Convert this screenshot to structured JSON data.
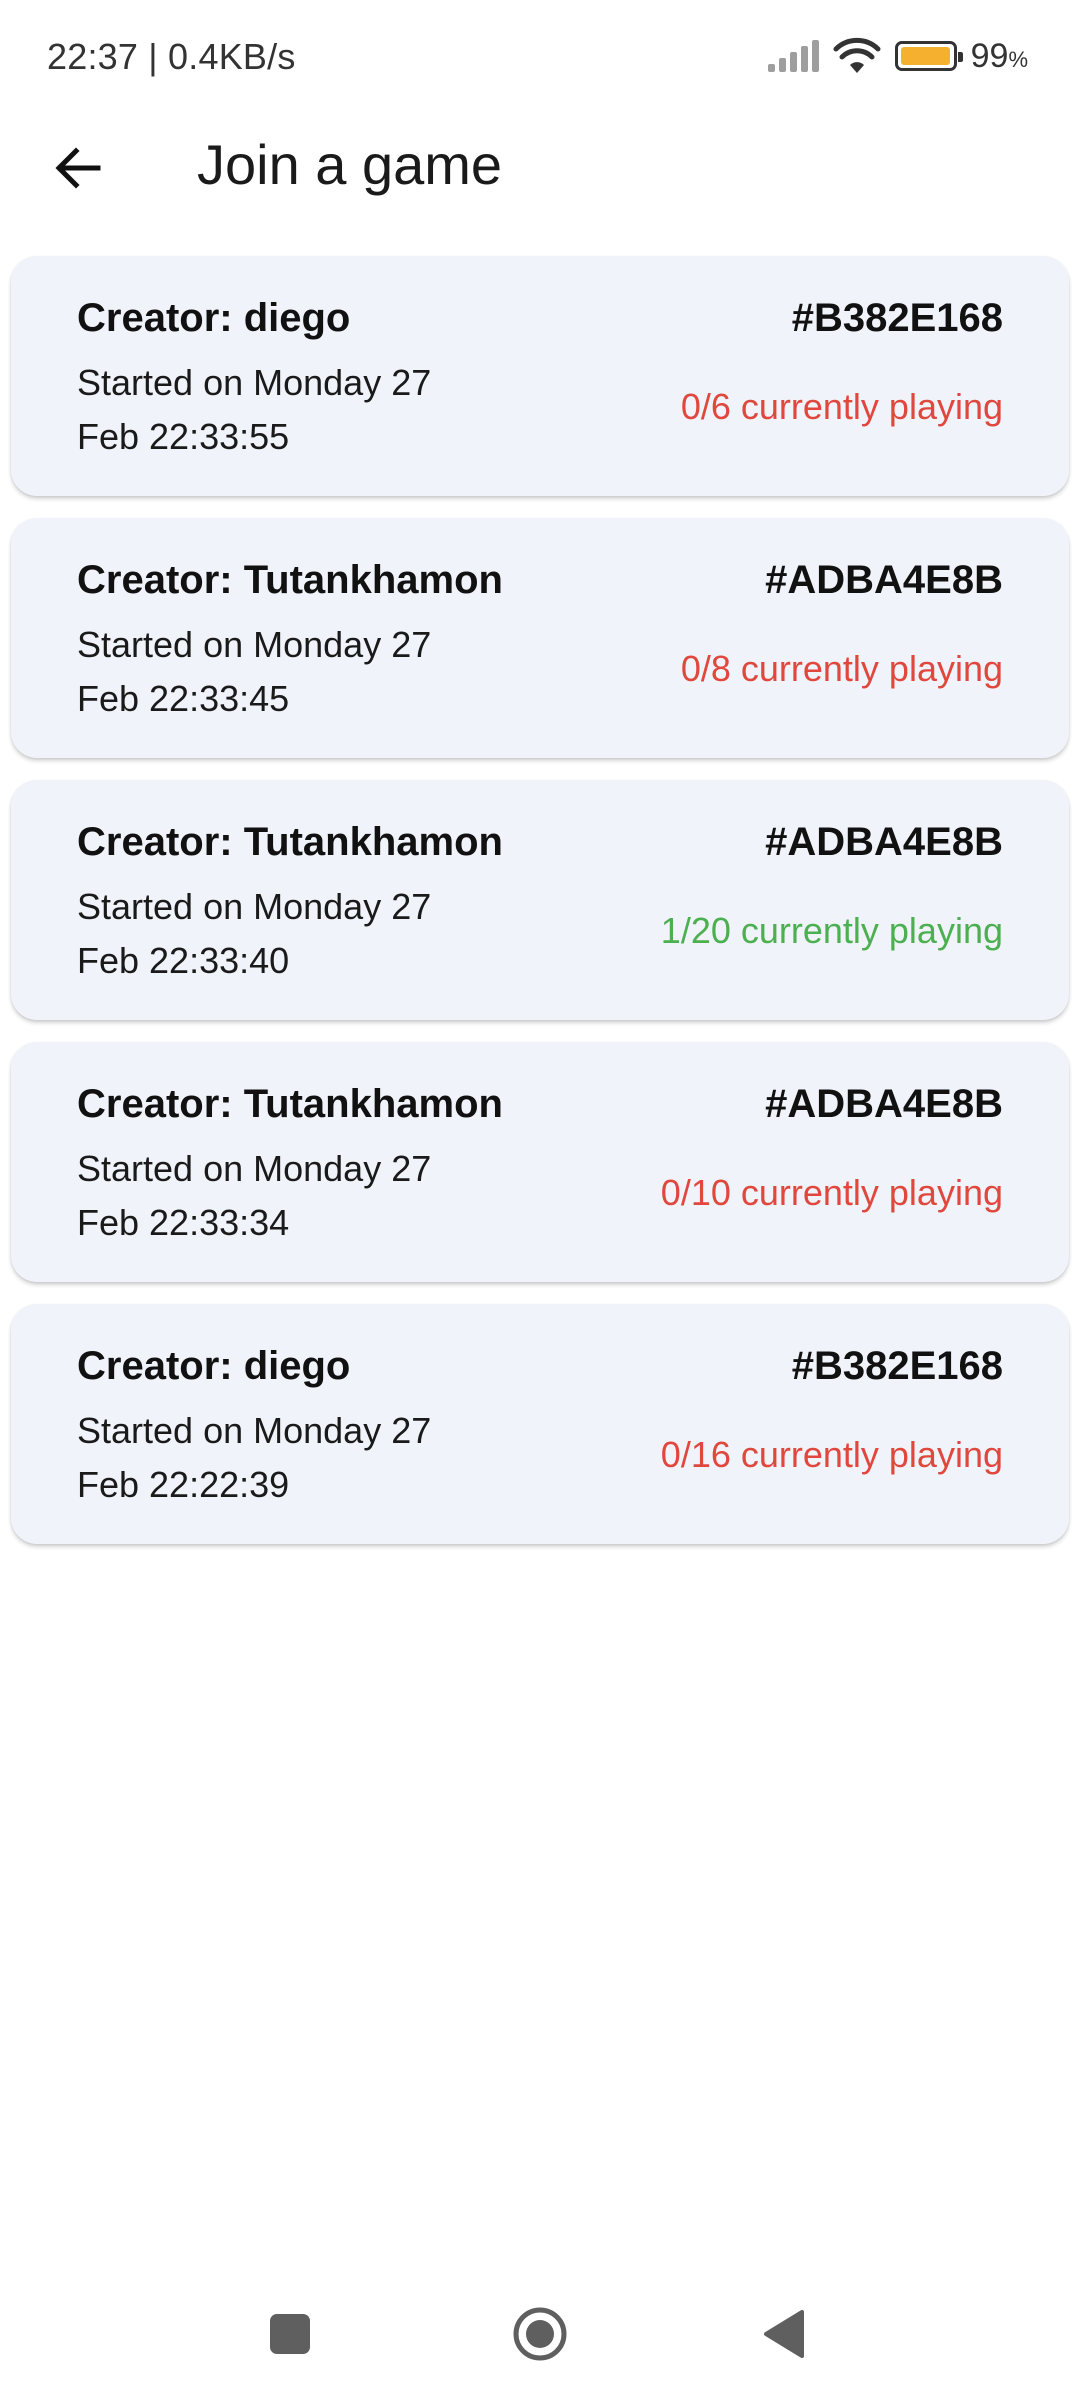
{
  "status_bar": {
    "time_speed": "22:37 | 0.4KB/s",
    "battery_percent": "99",
    "battery_unit": "%",
    "battery_level": 0.99,
    "battery_color": "#f4b02e",
    "icons": [
      "signal-icon",
      "wifi-icon",
      "battery-icon"
    ]
  },
  "app_bar": {
    "back_icon": "arrow-left-icon",
    "title": "Join a game"
  },
  "colors": {
    "card_background": "#f0f3f9",
    "inactive_count": "#e0473d",
    "active_count": "#4caf50"
  },
  "games": [
    {
      "creator": "Creator: diego",
      "id": "#B382E168",
      "started": "Started on Monday 27 Feb 22:33:55",
      "playing": "0/6 currently playing",
      "has_players": false
    },
    {
      "creator": "Creator: Tutankhamon",
      "id": "#ADBA4E8B",
      "started": "Started on Monday 27 Feb 22:33:45",
      "playing": "0/8 currently playing",
      "has_players": false
    },
    {
      "creator": "Creator: Tutankhamon",
      "id": "#ADBA4E8B",
      "started": "Started on Monday 27 Feb 22:33:40",
      "playing": "1/20 currently playing",
      "has_players": true
    },
    {
      "creator": "Creator: Tutankhamon",
      "id": "#ADBA4E8B",
      "started": "Started on Monday 27 Feb 22:33:34",
      "playing": "0/10 currently playing",
      "has_players": false
    },
    {
      "creator": "Creator: diego",
      "id": "#B382E168",
      "started": "Started on Monday 27 Feb 22:22:39",
      "playing": "0/16 currently playing",
      "has_players": false
    }
  ],
  "nav_bar": {
    "icons": [
      "recents-square-icon",
      "home-circle-icon",
      "back-triangle-icon"
    ]
  }
}
